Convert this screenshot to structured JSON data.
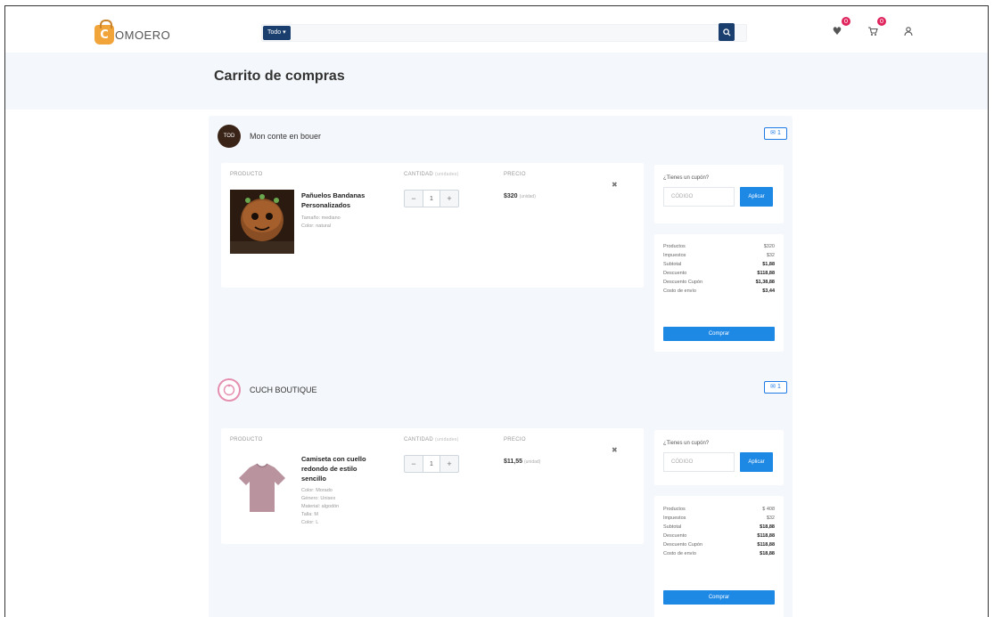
{
  "header": {
    "logo_text": "OMOERO",
    "logo_letter": "C",
    "category_button": "Todo",
    "search_placeholder": "",
    "favorites_count": "0",
    "cart_count": "0"
  },
  "page": {
    "title": "Carrito de compras"
  },
  "columns": {
    "product": "Producto",
    "quantity": "Cantidad",
    "quantity_note": "(unidades)",
    "price": "Precio"
  },
  "shops": [
    {
      "name": "Mon conte en bouer",
      "avatar_text": "TOD",
      "chat_label": "✉ 1",
      "product": {
        "name": "Pañuelos Bandanas Personalizados",
        "details": [
          "Tamaño: mediano",
          "Color: natural"
        ],
        "quantity": "1",
        "price": "$320",
        "price_note": "(unidad)"
      },
      "coupon": {
        "title": "¿Tienes un cupón?",
        "placeholder": "CÓDIGO",
        "button": "Aplicar"
      },
      "summary": [
        {
          "label": "Productos",
          "value": "$320"
        },
        {
          "label": "Impuestos",
          "value": "$32"
        },
        {
          "label": "Subtotal",
          "value": "$1,88"
        },
        {
          "label": "Descuento",
          "value": "$118,88"
        },
        {
          "label": "Descuento Cupón",
          "value": "$1,38,88"
        },
        {
          "label": "Costo de envío",
          "value": "$3,44"
        }
      ],
      "buy_button": "Comprar"
    },
    {
      "name": "CUCH BOUTIQUE",
      "avatar_text": "",
      "chat_label": "✉ 1",
      "product": {
        "name": "Camiseta con cuello redondo de estilo sencillo",
        "details": [
          "Color: Morado",
          "Género: Unisex",
          "Material: algodón",
          "Talla: M",
          "Color: L"
        ],
        "quantity": "1",
        "price": "$11,55",
        "price_note": "(unidad)"
      },
      "coupon": {
        "title": "¿Tienes un cupón?",
        "placeholder": "CÓDIGO",
        "button": "Aplicar"
      },
      "summary": [
        {
          "label": "Productos",
          "value": "$ 408"
        },
        {
          "label": "Impuestos",
          "value": "$32"
        },
        {
          "label": "Subtotal",
          "value": "$18,88"
        },
        {
          "label": "Descuento",
          "value": "$118,88"
        },
        {
          "label": "Descuento Cupón",
          "value": "$118,88"
        },
        {
          "label": "Costo de envío",
          "value": "$18,88"
        }
      ],
      "buy_button": "Comprar"
    }
  ]
}
